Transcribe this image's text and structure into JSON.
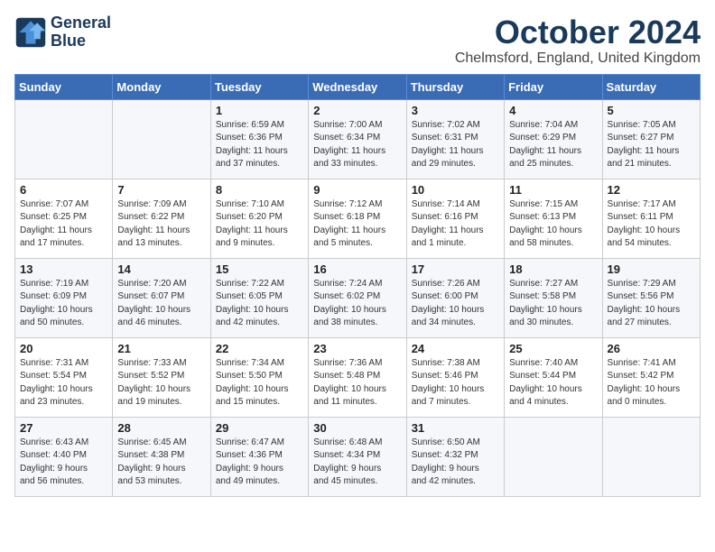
{
  "logo": {
    "line1": "General",
    "line2": "Blue"
  },
  "header": {
    "month": "October 2024",
    "location": "Chelmsford, England, United Kingdom"
  },
  "weekdays": [
    "Sunday",
    "Monday",
    "Tuesday",
    "Wednesday",
    "Thursday",
    "Friday",
    "Saturday"
  ],
  "weeks": [
    [
      {
        "day": "",
        "info": ""
      },
      {
        "day": "",
        "info": ""
      },
      {
        "day": "1",
        "info": "Sunrise: 6:59 AM\nSunset: 6:36 PM\nDaylight: 11 hours\nand 37 minutes."
      },
      {
        "day": "2",
        "info": "Sunrise: 7:00 AM\nSunset: 6:34 PM\nDaylight: 11 hours\nand 33 minutes."
      },
      {
        "day": "3",
        "info": "Sunrise: 7:02 AM\nSunset: 6:31 PM\nDaylight: 11 hours\nand 29 minutes."
      },
      {
        "day": "4",
        "info": "Sunrise: 7:04 AM\nSunset: 6:29 PM\nDaylight: 11 hours\nand 25 minutes."
      },
      {
        "day": "5",
        "info": "Sunrise: 7:05 AM\nSunset: 6:27 PM\nDaylight: 11 hours\nand 21 minutes."
      }
    ],
    [
      {
        "day": "6",
        "info": "Sunrise: 7:07 AM\nSunset: 6:25 PM\nDaylight: 11 hours\nand 17 minutes."
      },
      {
        "day": "7",
        "info": "Sunrise: 7:09 AM\nSunset: 6:22 PM\nDaylight: 11 hours\nand 13 minutes."
      },
      {
        "day": "8",
        "info": "Sunrise: 7:10 AM\nSunset: 6:20 PM\nDaylight: 11 hours\nand 9 minutes."
      },
      {
        "day": "9",
        "info": "Sunrise: 7:12 AM\nSunset: 6:18 PM\nDaylight: 11 hours\nand 5 minutes."
      },
      {
        "day": "10",
        "info": "Sunrise: 7:14 AM\nSunset: 6:16 PM\nDaylight: 11 hours\nand 1 minute."
      },
      {
        "day": "11",
        "info": "Sunrise: 7:15 AM\nSunset: 6:13 PM\nDaylight: 10 hours\nand 58 minutes."
      },
      {
        "day": "12",
        "info": "Sunrise: 7:17 AM\nSunset: 6:11 PM\nDaylight: 10 hours\nand 54 minutes."
      }
    ],
    [
      {
        "day": "13",
        "info": "Sunrise: 7:19 AM\nSunset: 6:09 PM\nDaylight: 10 hours\nand 50 minutes."
      },
      {
        "day": "14",
        "info": "Sunrise: 7:20 AM\nSunset: 6:07 PM\nDaylight: 10 hours\nand 46 minutes."
      },
      {
        "day": "15",
        "info": "Sunrise: 7:22 AM\nSunset: 6:05 PM\nDaylight: 10 hours\nand 42 minutes."
      },
      {
        "day": "16",
        "info": "Sunrise: 7:24 AM\nSunset: 6:02 PM\nDaylight: 10 hours\nand 38 minutes."
      },
      {
        "day": "17",
        "info": "Sunrise: 7:26 AM\nSunset: 6:00 PM\nDaylight: 10 hours\nand 34 minutes."
      },
      {
        "day": "18",
        "info": "Sunrise: 7:27 AM\nSunset: 5:58 PM\nDaylight: 10 hours\nand 30 minutes."
      },
      {
        "day": "19",
        "info": "Sunrise: 7:29 AM\nSunset: 5:56 PM\nDaylight: 10 hours\nand 27 minutes."
      }
    ],
    [
      {
        "day": "20",
        "info": "Sunrise: 7:31 AM\nSunset: 5:54 PM\nDaylight: 10 hours\nand 23 minutes."
      },
      {
        "day": "21",
        "info": "Sunrise: 7:33 AM\nSunset: 5:52 PM\nDaylight: 10 hours\nand 19 minutes."
      },
      {
        "day": "22",
        "info": "Sunrise: 7:34 AM\nSunset: 5:50 PM\nDaylight: 10 hours\nand 15 minutes."
      },
      {
        "day": "23",
        "info": "Sunrise: 7:36 AM\nSunset: 5:48 PM\nDaylight: 10 hours\nand 11 minutes."
      },
      {
        "day": "24",
        "info": "Sunrise: 7:38 AM\nSunset: 5:46 PM\nDaylight: 10 hours\nand 7 minutes."
      },
      {
        "day": "25",
        "info": "Sunrise: 7:40 AM\nSunset: 5:44 PM\nDaylight: 10 hours\nand 4 minutes."
      },
      {
        "day": "26",
        "info": "Sunrise: 7:41 AM\nSunset: 5:42 PM\nDaylight: 10 hours\nand 0 minutes."
      }
    ],
    [
      {
        "day": "27",
        "info": "Sunrise: 6:43 AM\nSunset: 4:40 PM\nDaylight: 9 hours\nand 56 minutes."
      },
      {
        "day": "28",
        "info": "Sunrise: 6:45 AM\nSunset: 4:38 PM\nDaylight: 9 hours\nand 53 minutes."
      },
      {
        "day": "29",
        "info": "Sunrise: 6:47 AM\nSunset: 4:36 PM\nDaylight: 9 hours\nand 49 minutes."
      },
      {
        "day": "30",
        "info": "Sunrise: 6:48 AM\nSunset: 4:34 PM\nDaylight: 9 hours\nand 45 minutes."
      },
      {
        "day": "31",
        "info": "Sunrise: 6:50 AM\nSunset: 4:32 PM\nDaylight: 9 hours\nand 42 minutes."
      },
      {
        "day": "",
        "info": ""
      },
      {
        "day": "",
        "info": ""
      }
    ]
  ]
}
